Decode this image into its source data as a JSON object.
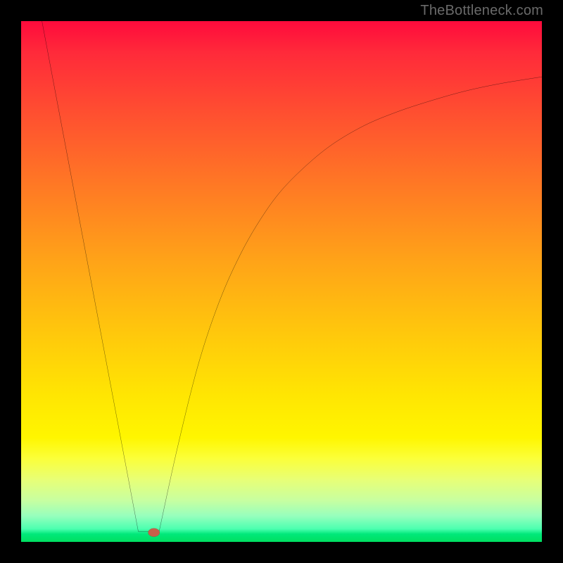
{
  "watermark": "TheBottleneck.com",
  "chart_data": {
    "type": "line",
    "title": "",
    "xlabel": "",
    "ylabel": "",
    "xlim": [
      0,
      100
    ],
    "ylim": [
      0,
      100
    ],
    "grid": false,
    "legend": false,
    "background_gradient": {
      "stops": [
        {
          "pos": 0.0,
          "color": "#ff0a3c"
        },
        {
          "pos": 0.18,
          "color": "#ff5030"
        },
        {
          "pos": 0.46,
          "color": "#ffa318"
        },
        {
          "pos": 0.72,
          "color": "#ffe602"
        },
        {
          "pos": 0.88,
          "color": "#e8ff76"
        },
        {
          "pos": 0.98,
          "color": "#00e87a"
        },
        {
          "pos": 1.0,
          "color": "#00e060"
        }
      ]
    },
    "series": [
      {
        "name": "left-branch",
        "x": [
          4,
          22.5
        ],
        "y": [
          100,
          2
        ],
        "stroke": "#000000"
      },
      {
        "name": "flat-min",
        "x": [
          22.5,
          26.5
        ],
        "y": [
          2,
          2
        ],
        "stroke": "#000000"
      },
      {
        "name": "right-branch",
        "x": [
          26.5,
          30,
          34,
          38,
          42,
          46,
          50,
          55,
          60,
          66,
          72,
          78,
          85,
          92,
          100
        ],
        "y": [
          2,
          18,
          34,
          46,
          55,
          62,
          67.5,
          72.5,
          76.5,
          80,
          82.5,
          84.5,
          86.5,
          88,
          89.3
        ],
        "stroke": "#000000"
      }
    ],
    "marker": {
      "name": "optimum-point",
      "x": 25.5,
      "y": 1.8,
      "rx": 1.1,
      "ry": 0.8,
      "fill": "#c8604a"
    }
  }
}
